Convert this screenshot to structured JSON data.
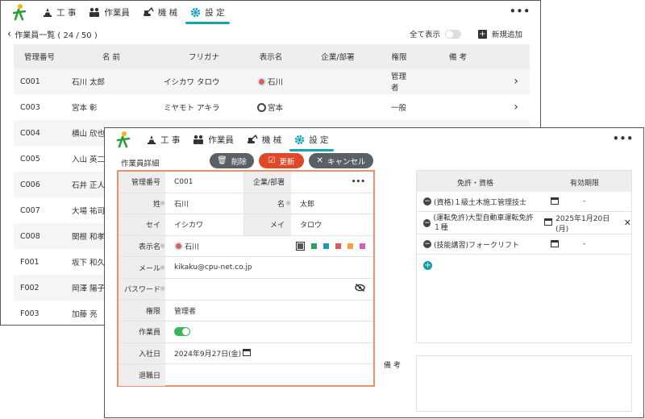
{
  "nav": {
    "items": [
      {
        "label": "工 事",
        "icon": "cone-icon"
      },
      {
        "label": "作業員",
        "icon": "workers-icon"
      },
      {
        "label": "機 械",
        "icon": "excavator-icon"
      },
      {
        "label": "設 定",
        "icon": "gear-icon"
      }
    ],
    "more": "•••",
    "active_color": "#16a3b5"
  },
  "list": {
    "title": "作業員一覧 ( 24 / 50 )",
    "show_all_label": "全て表示",
    "add_label": "新規追加",
    "columns": [
      "管理番号",
      "名 前",
      "フリガナ",
      "表示名",
      "企業/部署",
      "権限",
      "備 考"
    ],
    "rows": [
      {
        "id": "C001",
        "name": "石川 太郎",
        "kana": "イシカワ タロウ",
        "display": "石川",
        "role": "管理者",
        "avatar_color": "#e25b5b"
      },
      {
        "id": "C003",
        "name": "宮本 彰",
        "kana": "ミヤモト アキラ",
        "display": "宮本",
        "role": "一般",
        "avatar_color": "#444444"
      },
      {
        "id": "C004",
        "name": "横山 欣也"
      },
      {
        "id": "C005",
        "name": "入山 英二"
      },
      {
        "id": "C006",
        "name": "石井 正人"
      },
      {
        "id": "C007",
        "name": "大場 祐司"
      },
      {
        "id": "C008",
        "name": "関根 和孝"
      },
      {
        "id": "F001",
        "name": "坂下 和久"
      },
      {
        "id": "F002",
        "name": "岡澤 陽子"
      },
      {
        "id": "F003",
        "name": "加藤 亮"
      }
    ]
  },
  "detail": {
    "title": "作業員詳細",
    "delete_label": "削除",
    "update_label": "更新",
    "cancel_label": "キャンセル",
    "fields": {
      "id_label": "管理番号",
      "id_value": "C001",
      "company_label": "企業/部署",
      "company_more": "•••",
      "last_label": "姓",
      "last_value": "石川",
      "first_label": "名",
      "first_value": "太郎",
      "last_kana_label": "セイ",
      "last_kana_value": "イシカワ",
      "first_kana_label": "メイ",
      "first_kana_value": "タロウ",
      "display_label": "表示名",
      "display_value": "石川",
      "email_label": "メール",
      "email_value": "kikaku@cpu-net.co.jp",
      "password_label": "パスワード",
      "role_label": "権限",
      "role_value": "管理者",
      "worker_label": "作業員",
      "hire_label": "入社日",
      "hire_value": "2024年9月27日(金)",
      "retire_label": "退職日"
    },
    "colors": [
      "#555555",
      "#2e9e5b",
      "#1a9ab5",
      "#e25b5b",
      "#f2a23a",
      "#d65fb5"
    ],
    "license": {
      "col_license": "免許・資格",
      "col_expiry": "有効期限",
      "items": [
        {
          "name": "(資格)１級土木施工管理技士",
          "expiry": "-"
        },
        {
          "name": "(運転免許)大型自動車運転免許１種",
          "expiry": "2025年1月20日(月)"
        },
        {
          "name": "(技能講習)フォークリフト",
          "expiry": "-"
        }
      ]
    },
    "memo_label": "備 考"
  }
}
